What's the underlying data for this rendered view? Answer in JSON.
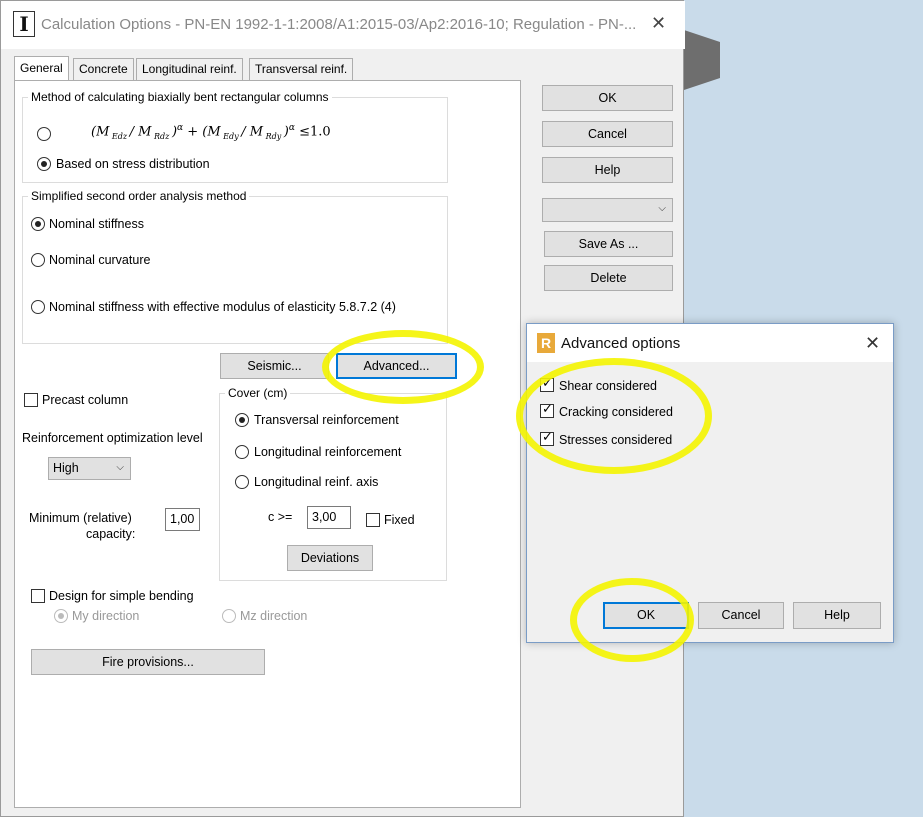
{
  "main": {
    "title": "Calculation Options - PN-EN 1992-1-1:2008/A1:2015-03/Ap2:2016-10;   Regulation - PN-...",
    "tabs": [
      "General",
      "Concrete",
      "Longitudinal reinf.",
      "Transversal reinf."
    ],
    "biaxial": {
      "legend": "Method of calculating biaxially bent rectangular columns",
      "formula": "(M_Edz / M_Rdz)^α + (M_Edy / M_Rdy)^α ≤ 1.0",
      "stress_label": "Based on stress distribution"
    },
    "second_order": {
      "legend": "Simplified second order analysis method",
      "options": [
        "Nominal stiffness",
        "Nominal curvature",
        "Nominal stiffness with effective modulus of elasticity 5.8.7.2 (4)"
      ]
    },
    "seismic_button": "Seismic...",
    "advanced_button": "Advanced...",
    "precast_label": "Precast column",
    "optimization": {
      "label": "Reinforcement optimization level",
      "value": "High"
    },
    "min_capacity": {
      "label_line1": "Minimum (relative)",
      "label_line2": "capacity:",
      "value": "1,00"
    },
    "cover": {
      "legend": "Cover (cm)",
      "options": [
        "Transversal reinforcement",
        "Longitudinal reinforcement",
        "Longitudinal reinf. axis"
      ],
      "c_label": "c >=",
      "c_value": "3,00",
      "fixed_label": "Fixed",
      "deviations_button": "Deviations"
    },
    "simple_bending": {
      "label": "Design for simple bending",
      "my": "My direction",
      "mz": "Mz direction"
    },
    "fire_button": "Fire provisions...",
    "side_buttons": {
      "ok": "OK",
      "cancel": "Cancel",
      "help": "Help",
      "save_as": "Save As ...",
      "delete": "Delete",
      "combo_value": ""
    }
  },
  "advanced": {
    "title": "Advanced options",
    "checks": [
      "Shear considered",
      "Cracking considered",
      "Stresses considered"
    ],
    "ok": "OK",
    "cancel": "Cancel",
    "help": "Help"
  },
  "colors": {
    "highlight": "#f4f400",
    "focus": "#0078d7"
  }
}
